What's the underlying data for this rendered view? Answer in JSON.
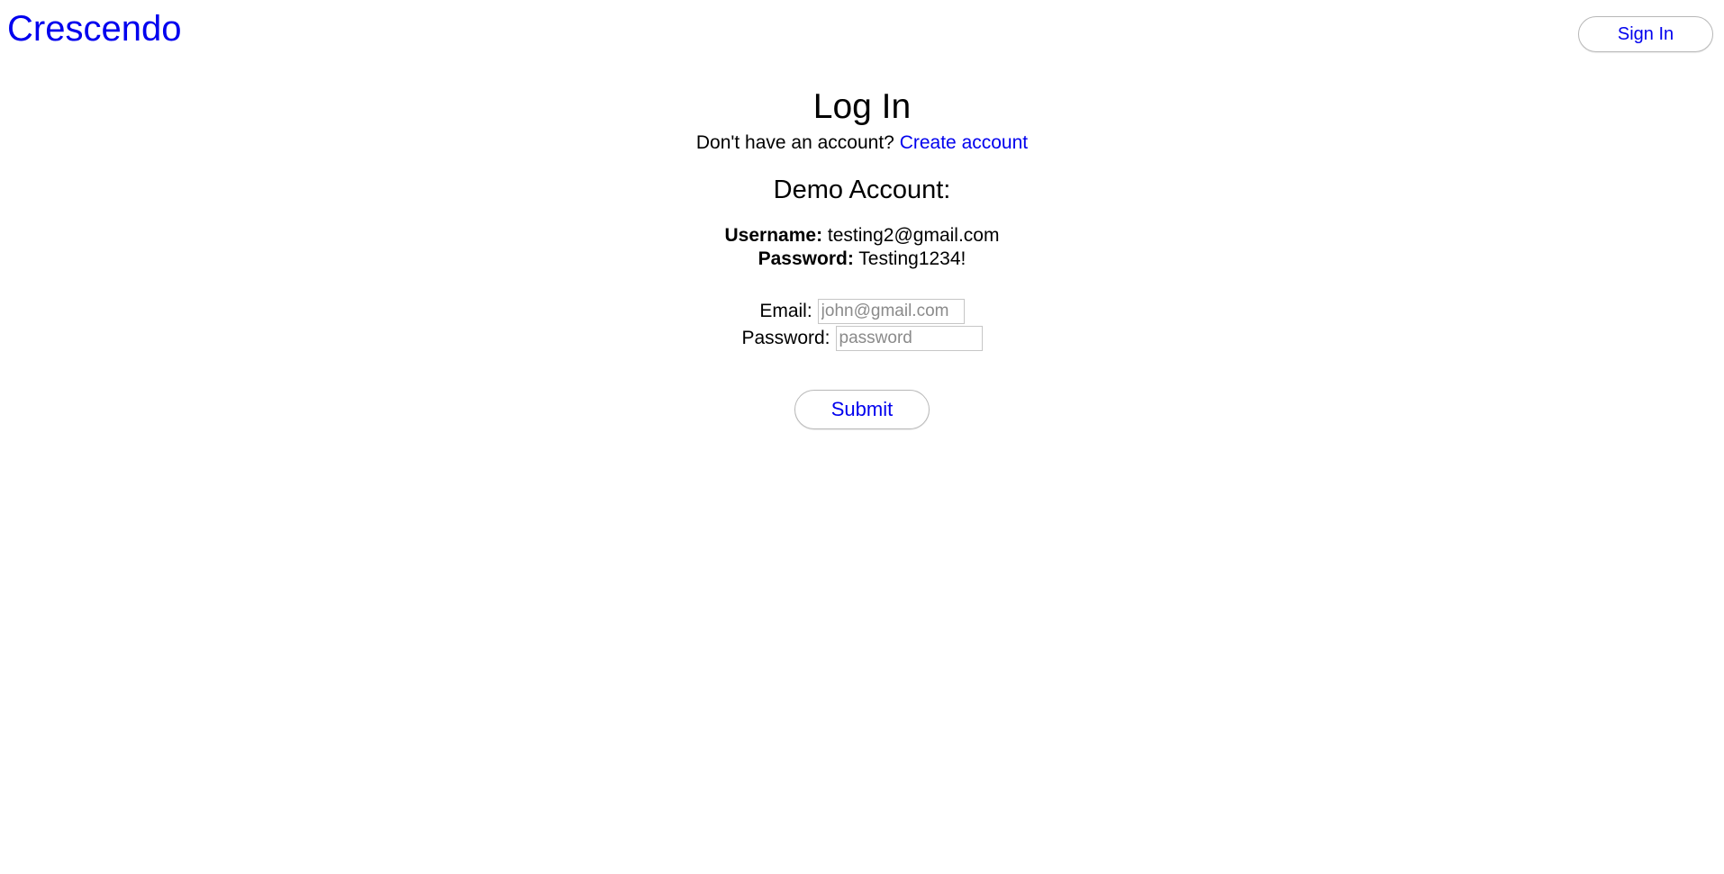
{
  "header": {
    "brand": "Crescendo",
    "sign_in_label": "Sign In"
  },
  "login": {
    "title": "Log In",
    "no_account_text": "Don't have an account? ",
    "create_account_link": "Create account"
  },
  "demo": {
    "title": "Demo Account:",
    "username_label": "Username:",
    "username_value": "testing2@gmail.com",
    "password_label": "Password:",
    "password_value": "Testing1234!"
  },
  "form": {
    "email_label": "Email:",
    "email_placeholder": "john@gmail.com",
    "email_value": "",
    "password_label": "Password:",
    "password_placeholder": "password",
    "password_value": "",
    "submit_label": "Submit"
  },
  "colors": {
    "link": "#0000ee",
    "text": "#000000",
    "background": "#ffffff"
  }
}
